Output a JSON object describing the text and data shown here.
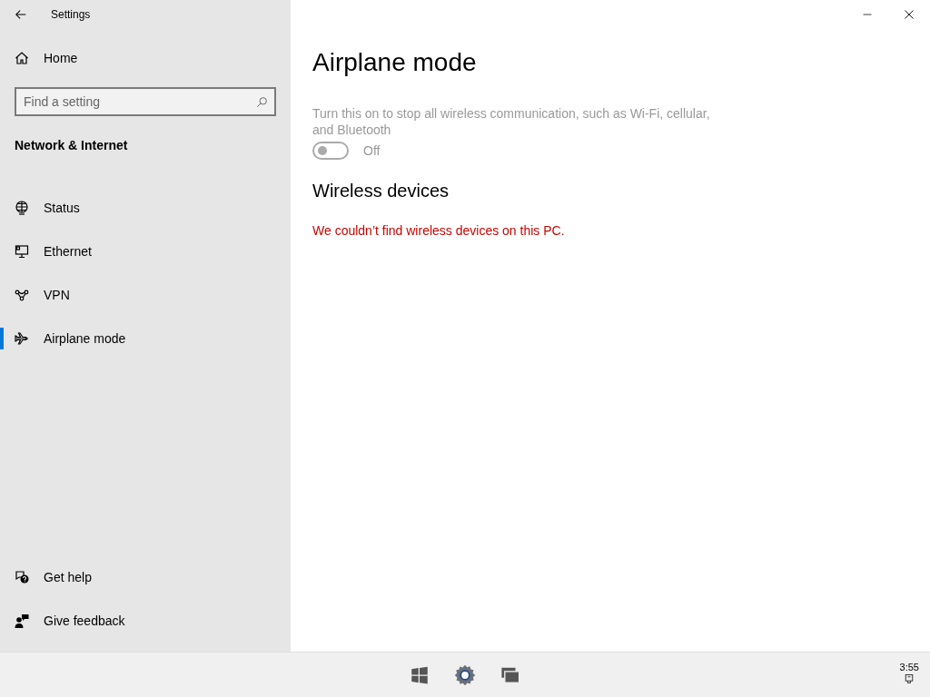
{
  "window": {
    "title": "Settings"
  },
  "sidebar": {
    "home": "Home",
    "search": {
      "placeholder": "Find a setting"
    },
    "section": "Network & Internet",
    "items": [
      {
        "label": "Status",
        "kind": "globe",
        "selected": false
      },
      {
        "label": "Ethernet",
        "kind": "ethernet",
        "selected": false
      },
      {
        "label": "VPN",
        "kind": "vpn",
        "selected": false
      },
      {
        "label": "Airplane mode",
        "kind": "airplane",
        "selected": true
      }
    ],
    "footer": [
      {
        "label": "Get help",
        "kind": "help"
      },
      {
        "label": "Give feedback",
        "kind": "feedback"
      }
    ]
  },
  "main": {
    "title": "Airplane mode",
    "description": "Turn this on to stop all wireless communication, such as Wi-Fi, cellular, and Bluetooth",
    "toggle": {
      "on": false,
      "disabled": true,
      "label": "Off"
    },
    "section": "Wireless devices",
    "message": "We couldn’t find wireless devices on this PC."
  },
  "taskbar": {
    "clock": "3:55"
  }
}
